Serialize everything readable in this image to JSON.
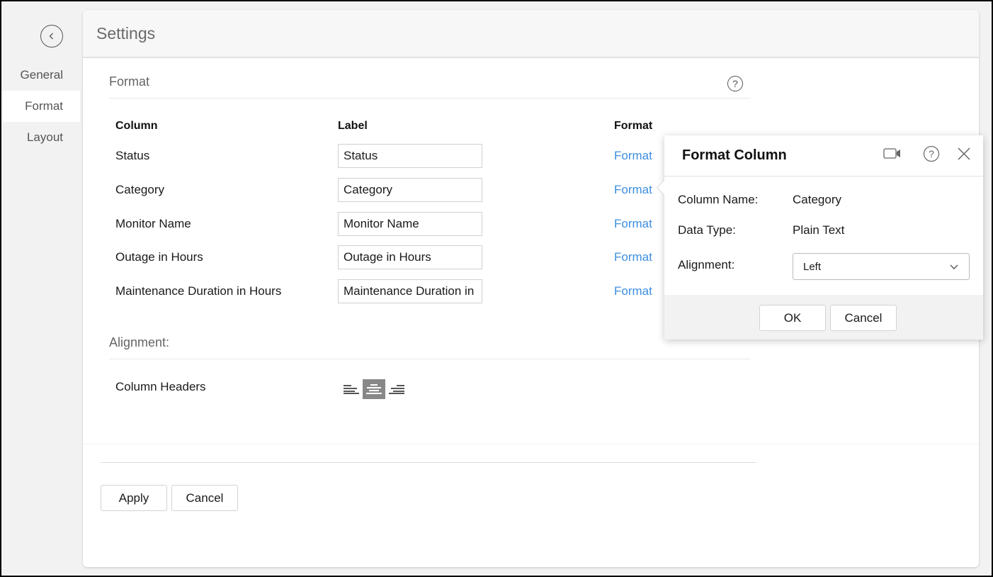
{
  "sidebar": {
    "back_icon": "chevron-left-circle-icon",
    "items": [
      {
        "label": "General",
        "active": false
      },
      {
        "label": "Format",
        "active": true
      },
      {
        "label": "Layout",
        "active": false
      }
    ]
  },
  "header": {
    "title": "Settings"
  },
  "format_section": {
    "title": "Format",
    "help_icon": "question-circle-icon",
    "columns": {
      "column": "Column",
      "label": "Label",
      "format": "Format"
    },
    "rows": [
      {
        "column": "Status",
        "label": "Status",
        "link": "Format"
      },
      {
        "column": "Category",
        "label": "Category",
        "link": "Format"
      },
      {
        "column": "Monitor Name",
        "label": "Monitor Name",
        "link": "Format"
      },
      {
        "column": "Outage in Hours",
        "label": "Outage in Hours",
        "link": "Format"
      },
      {
        "column": "Maintenance Duration in Hours",
        "label": "Maintenance Duration in Hours",
        "link": "Format"
      }
    ]
  },
  "alignment_section": {
    "title": "Alignment:",
    "column_headers_label": "Column Headers",
    "options": [
      "align-left",
      "align-center",
      "align-right"
    ],
    "selected": "align-center"
  },
  "footer": {
    "apply_label": "Apply",
    "cancel_label": "Cancel"
  },
  "format_popup": {
    "title": "Format Column",
    "video_icon": "video-camera-icon",
    "help_icon": "question-circle-icon",
    "close_icon": "close-icon",
    "fields": {
      "column_name_label": "Column Name:",
      "column_name_value": "Category",
      "data_type_label": "Data Type:",
      "data_type_value": "Plain Text",
      "alignment_label": "Alignment:",
      "alignment_value": "Left"
    },
    "ok_label": "OK",
    "cancel_label": "Cancel"
  },
  "colors": {
    "link": "#3d8ee0",
    "active_align_bg": "#888888",
    "page_bg": "#f2f2f2"
  }
}
